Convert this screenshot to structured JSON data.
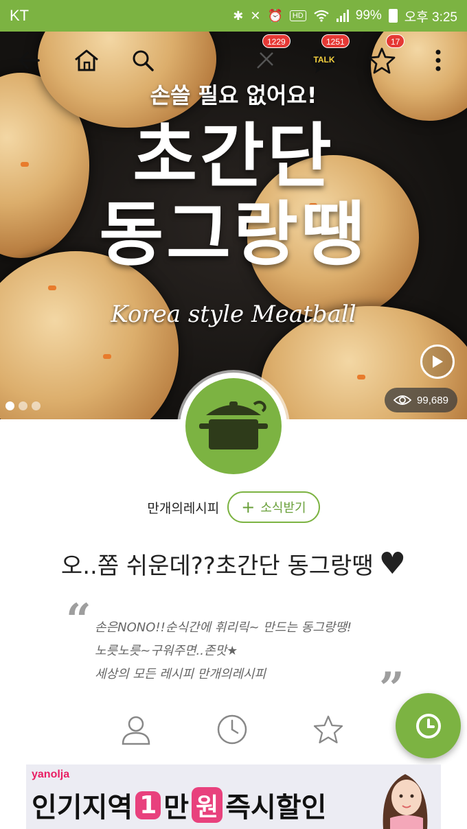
{
  "status_bar": {
    "carrier": "KT",
    "battery": "99%",
    "time": "오후 3:25",
    "hd_label": "HD"
  },
  "nav": {
    "badges": {
      "second": "1229",
      "talk": "1251",
      "star": "17"
    },
    "talk_label": "TALK"
  },
  "hero": {
    "subtitle": "손쓸 필요 없어요!",
    "title_line1": "초간단",
    "title_line2": "동그랑땡",
    "english_title": "Korea style Meatball",
    "views": "99,689",
    "slide_count": 3,
    "active_slide": 0
  },
  "author": {
    "name": "만개의레시피",
    "follow_label": "소식받기"
  },
  "recipe": {
    "title": "오..쫌 쉬운데??초간단 동그랑땡",
    "heart": "♥",
    "description": [
      "손은NONO!!순식간에 휘리릭~ 만드는 동그랑땡!",
      "노릇노릇~구워주면..존맛★",
      "세상의 모든 레시피 만개의레시피"
    ]
  },
  "actions": [
    {
      "icon": "user-icon",
      "label": ""
    },
    {
      "icon": "clock-icon",
      "label": ""
    },
    {
      "icon": "star-icon",
      "label": ""
    }
  ],
  "ad": {
    "brand": "yanolja",
    "text_before": "인기지역",
    "pill1": "1",
    "pill2": "만",
    "pill3": "원",
    "text_after": "즉시할인"
  },
  "colors": {
    "accent": "#7cb342",
    "badge": "#e53935",
    "ad_pink": "#e8417d"
  }
}
